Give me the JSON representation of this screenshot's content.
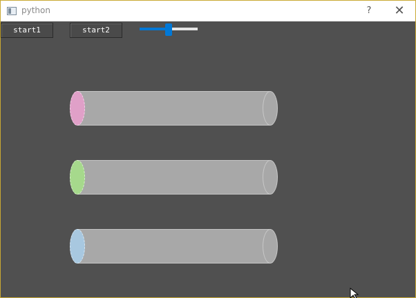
{
  "window": {
    "title": "python",
    "help_label": "?",
    "close_label": "✕"
  },
  "toolbar": {
    "start1_label": "start1",
    "start2_label": "start2"
  },
  "slider": {
    "value_fraction": 0.5
  },
  "cylinders": [
    {
      "cap_color": "#e0a0c8"
    },
    {
      "cap_color": "#a6d98c"
    },
    {
      "cap_color": "#a8c8e0"
    }
  ],
  "colors": {
    "background": "#505050",
    "accent": "#0078d7",
    "cylinder_body": "#a8a8a8"
  }
}
